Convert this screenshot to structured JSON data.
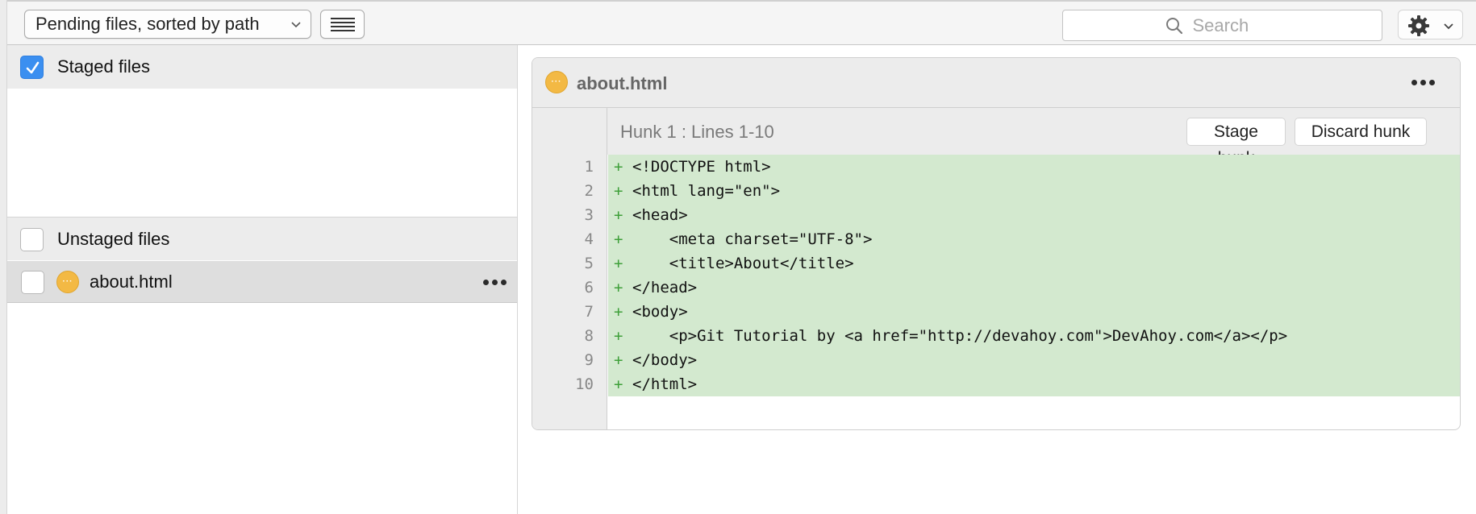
{
  "toolbar": {
    "sort_popup_label": "Pending files, sorted by path",
    "search_placeholder": "Search"
  },
  "left_panel": {
    "staged_header": {
      "label": "Staged files",
      "checked": true
    },
    "unstaged_header": {
      "label": "Unstaged files",
      "checked": false
    },
    "files": [
      {
        "name": "about.html",
        "status": "modified",
        "checked": false
      }
    ]
  },
  "diff": {
    "file_name": "about.html",
    "hunk_title": "Hunk 1 : Lines 1-10",
    "stage_hunk_label": "Stage hunk",
    "discard_hunk_label": "Discard hunk",
    "lines": [
      {
        "num": "1",
        "marker": "+",
        "text": "<!DOCTYPE html>"
      },
      {
        "num": "2",
        "marker": "+",
        "text": "<html lang=\"en\">"
      },
      {
        "num": "3",
        "marker": "+",
        "text": "<head>"
      },
      {
        "num": "4",
        "marker": "+",
        "text": "    <meta charset=\"UTF-8\">"
      },
      {
        "num": "5",
        "marker": "+",
        "text": "    <title>About</title>"
      },
      {
        "num": "6",
        "marker": "+",
        "text": "</head>"
      },
      {
        "num": "7",
        "marker": "+",
        "text": "<body>"
      },
      {
        "num": "8",
        "marker": "+",
        "text": "    <p>Git Tutorial by <a href=\"http://devahoy.com\">DevAhoy.com</a></p>"
      },
      {
        "num": "9",
        "marker": "+",
        "text": "</body>"
      },
      {
        "num": "10",
        "marker": "+",
        "text": "</html>"
      }
    ]
  },
  "colors": {
    "accent_blue": "#3b8ff0",
    "status_orange": "#f3b944",
    "added_line_bg": "#d3e9cf",
    "added_marker": "#3fa03a"
  },
  "icons": {
    "sort_chevron": "chevron-down-icon",
    "list_view": "list-icon",
    "search": "search-icon",
    "settings": "gear-icon",
    "more": "more-icon",
    "status": "modified-status-icon"
  }
}
